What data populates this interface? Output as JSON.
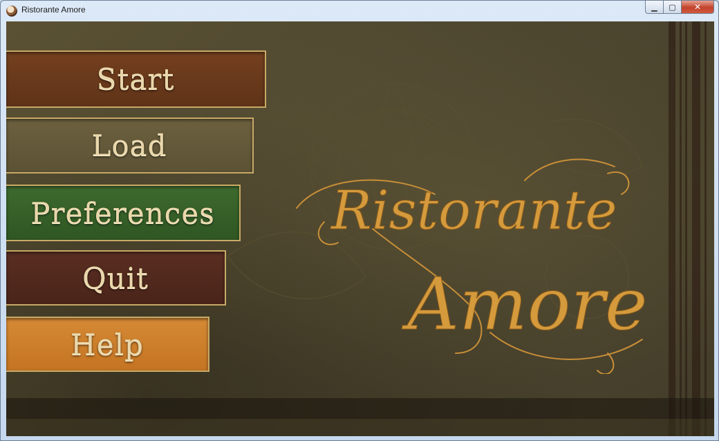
{
  "window": {
    "title": "Ristorante Amore",
    "controls": {
      "minimize": "▁",
      "maximize": "▢",
      "close": "✕"
    }
  },
  "menu": {
    "start": "Start",
    "load": "Load",
    "preferences": "Preferences",
    "quit": "Quit",
    "help": "Help"
  },
  "logo": {
    "line1": "Ristorante",
    "line2": "Amore"
  },
  "colors": {
    "accent_gold": "#d9a23f",
    "start_bg": "#6a3a1c",
    "load_bg": "#64593a",
    "preferences_bg": "#366128",
    "quit_bg": "#522a1e",
    "help_bg": "#d07e2c"
  }
}
